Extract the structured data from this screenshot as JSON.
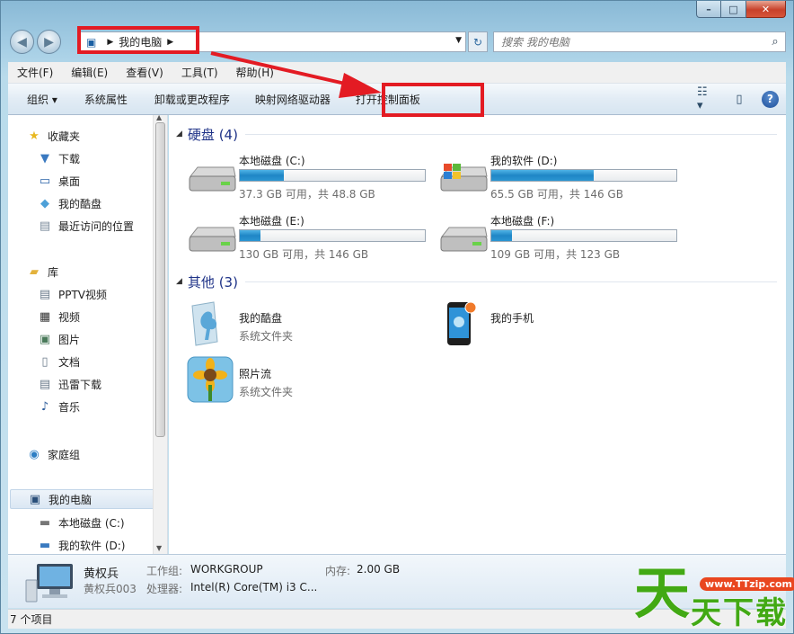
{
  "window": {
    "min_label": "–",
    "max_label": "□",
    "close_label": "✕"
  },
  "address": {
    "path_item": "我的电脑",
    "search_placeholder": "搜索 我的电脑"
  },
  "menu": [
    "文件(F)",
    "编辑(E)",
    "查看(V)",
    "工具(T)",
    "帮助(H)"
  ],
  "commands": {
    "organize": "组织 ▾",
    "system_properties": "系统属性",
    "uninstall": "卸载或更改程序",
    "map_drive": "映射网络驱动器",
    "control_panel": "打开控制面板"
  },
  "nav": {
    "favorites": "收藏夹",
    "downloads": "下载",
    "desktop": "桌面",
    "kudisk": "我的酷盘",
    "recent": "最近访问的位置",
    "libraries": "库",
    "pptv": "PPTV视频",
    "videos": "视频",
    "pictures": "图片",
    "documents": "文档",
    "xunlei": "迅雷下载",
    "music": "音乐",
    "homegroup": "家庭组",
    "computer": "我的电脑",
    "drive_c": "本地磁盘 (C:)",
    "drive_d": "我的软件 (D:)"
  },
  "groups": {
    "hard_disks": "硬盘 (4)",
    "others": "其他 (3)"
  },
  "drives": [
    {
      "name": "本地磁盘 (C:)",
      "free": "37.3 GB 可用，共 48.8 GB",
      "used_fraction": 0.236
    },
    {
      "name": "我的软件 (D:)",
      "free": "65.5 GB 可用，共 146 GB",
      "used_fraction": 0.551
    },
    {
      "name": "本地磁盘 (E:)",
      "free": "130 GB 可用，共 146 GB",
      "used_fraction": 0.11
    },
    {
      "name": "本地磁盘 (F:)",
      "free": "109 GB 可用，共 123 GB",
      "used_fraction": 0.114
    }
  ],
  "others": [
    {
      "name": "我的酷盘",
      "type": "系统文件夹"
    },
    {
      "name": "我的手机",
      "type": ""
    },
    {
      "name": "照片流",
      "type": "系统文件夹"
    }
  ],
  "details": {
    "computer_name": "黄权兵",
    "computer_sub": "黄权兵003",
    "workgroup_label": "工作组:",
    "workgroup_value": "WORKGROUP",
    "memory_label": "内存:",
    "memory_value": "2.00 GB",
    "cpu_label": "处理器:",
    "cpu_value": "Intel(R) Core(TM) i3 C..."
  },
  "status": {
    "count": "7 个项目"
  },
  "watermark": {
    "url": "www.TTzip.com",
    "big": "天",
    "small": "天下载"
  },
  "colors": {
    "highlight": "#e31b23",
    "drive_bar": "#1f86c6",
    "group_title": "#1e3287"
  }
}
